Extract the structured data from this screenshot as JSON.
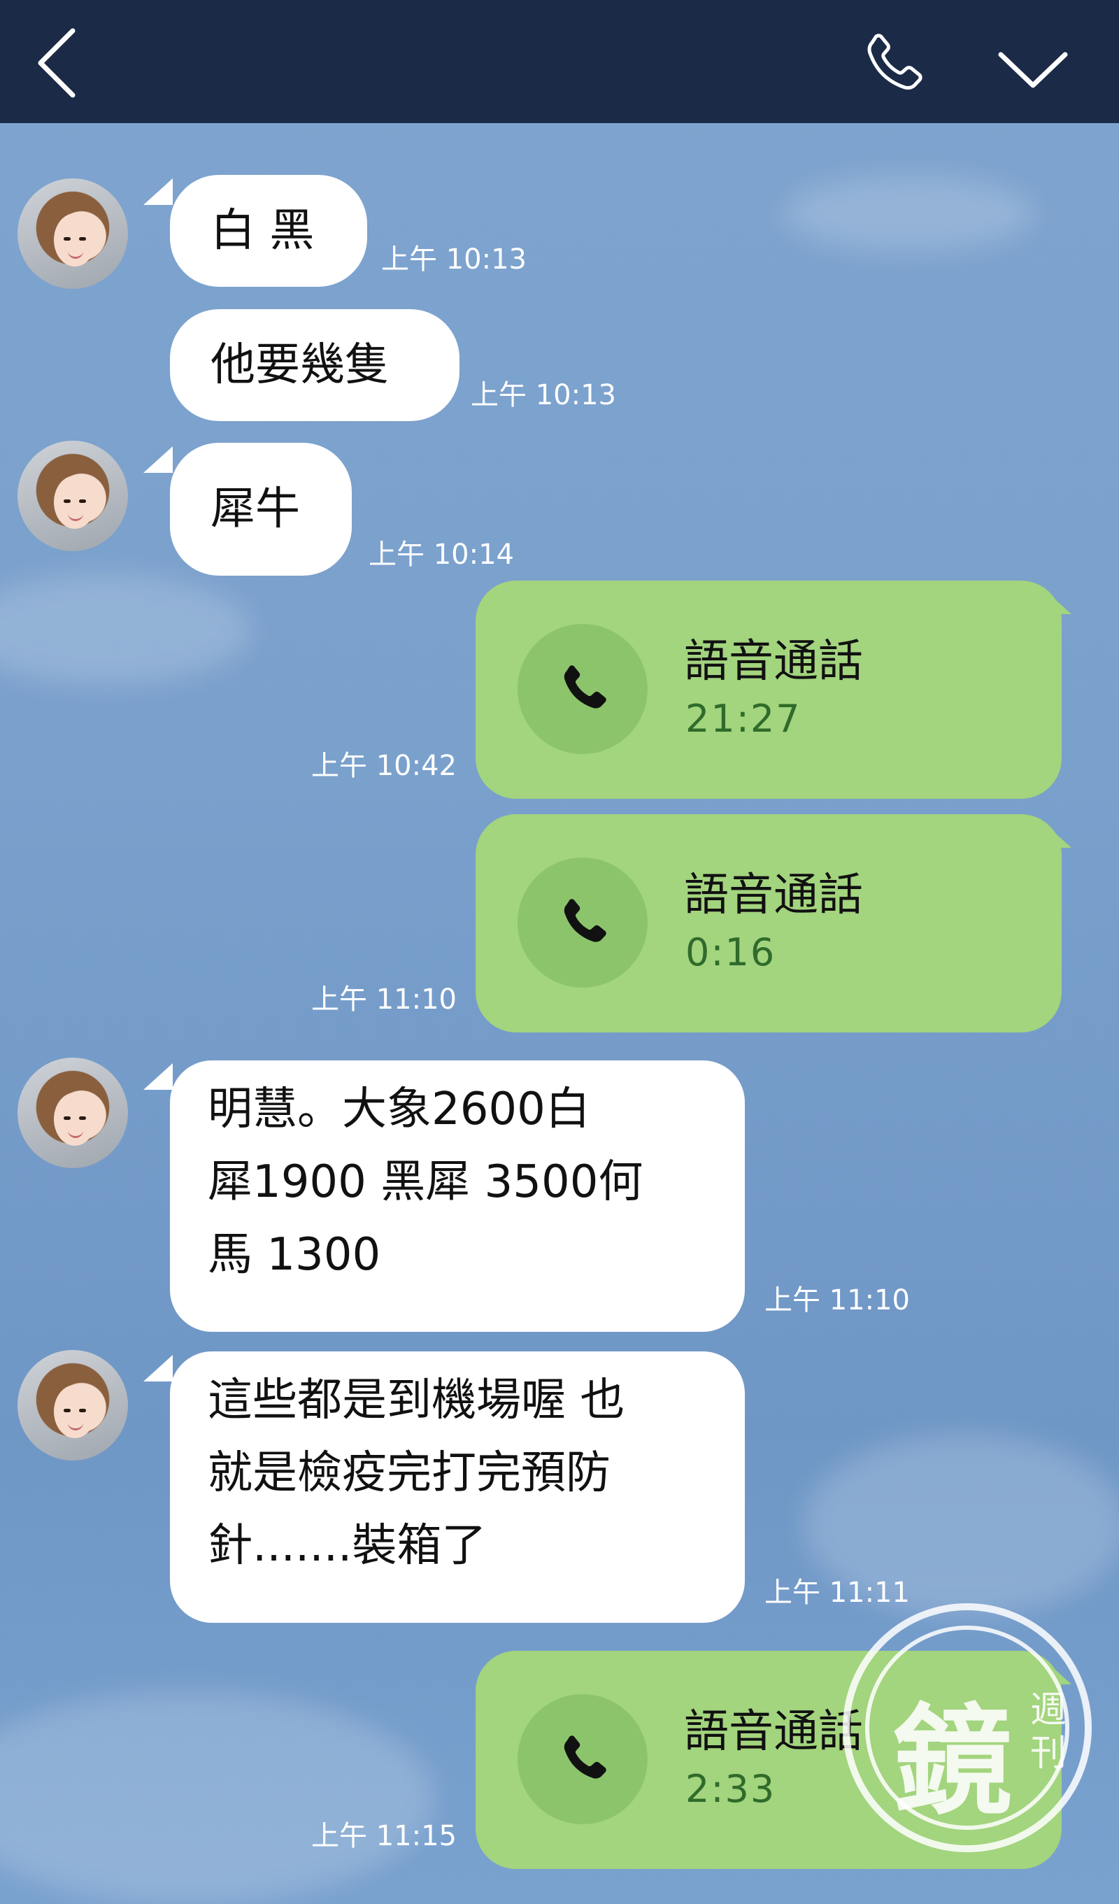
{
  "header": {
    "back_icon": "chevron-left-icon",
    "call_icon": "phone-icon",
    "menu_icon": "chevron-down-icon",
    "background": "#1b2a47"
  },
  "colors": {
    "incoming_bubble": "#ffffff",
    "outgoing_bubble": "#a3d47e",
    "call_duration": "#2f6b2a",
    "chat_background": "#7ea4cf"
  },
  "messages": [
    {
      "type": "incoming",
      "text": "白 黑",
      "time": "上午 10:13"
    },
    {
      "type": "incoming",
      "text": "他要幾隻",
      "time": "上午 10:13"
    },
    {
      "type": "incoming",
      "text": "犀牛",
      "time": "上午 10:14"
    },
    {
      "type": "call",
      "label": "語音通話",
      "duration": "21:27",
      "time": "上午 10:42"
    },
    {
      "type": "call",
      "label": "語音通話",
      "duration": "0:16",
      "time": "上午 11:10"
    },
    {
      "type": "incoming",
      "text": "明慧。大象2600白\n犀1900 黑犀 3500何\n馬 1300",
      "time": "上午 11:10"
    },
    {
      "type": "incoming",
      "text": "這些都是到機場喔 也\n就是檢疫完打完預防\n針.......裝箱了",
      "time": "上午 11:11"
    },
    {
      "type": "call",
      "label": "語音通話",
      "duration": "2:33",
      "time": "上午 11:15"
    }
  ],
  "watermark": {
    "big": "鏡",
    "small": "週刊"
  }
}
